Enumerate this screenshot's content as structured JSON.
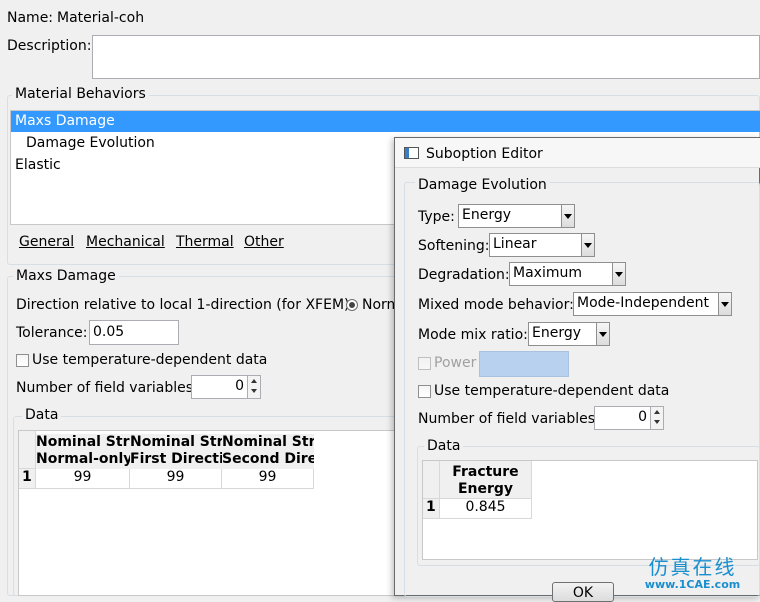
{
  "main": {
    "name_label": "Name:",
    "name_value": "Material-coh",
    "description_label": "Description:",
    "behaviors_title": "Material Behaviors",
    "behaviors": [
      "Maxs Damage",
      "Damage Evolution",
      "Elastic"
    ],
    "menus": [
      "General",
      "Mechanical",
      "Thermal",
      "Other"
    ],
    "section_title": "Maxs Damage",
    "direction_label": "Direction relative to local 1-direction (for XFEM):",
    "direction_option": "Norm",
    "tolerance_label": "Tolerance:",
    "tolerance_value": "0.05",
    "temp_dep_label": "Use temperature-dependent data",
    "field_vars_label": "Number of field variables:",
    "field_vars_value": "0",
    "data_title": "Data",
    "table": {
      "headers": [
        [
          "Nominal Stress",
          "Normal-only Mode"
        ],
        [
          "Nominal Stress",
          "First Direction"
        ],
        [
          "Nominal Stress",
          "Second Direction"
        ]
      ],
      "row_number": "1",
      "values": [
        "99",
        "99",
        "99"
      ]
    }
  },
  "dialog": {
    "title": "Suboption Editor",
    "group_title": "Damage Evolution",
    "type_label": "Type:",
    "type_value": "Energy",
    "softening_label": "Softening:",
    "softening_value": "Linear",
    "degradation_label": "Degradation:",
    "degradation_value": "Maximum",
    "mixed_label": "Mixed mode behavior:",
    "mixed_value": "Mode-Independent",
    "ratio_label": "Mode mix ratio:",
    "ratio_value": "Energy",
    "power_label": "Power",
    "temp_dep_label": "Use temperature-dependent data",
    "field_vars_label": "Number of field variables:",
    "field_vars_value": "0",
    "data_title": "Data",
    "table": {
      "header_line1": "Fracture",
      "header_line2": "Energy",
      "row_number": "1",
      "value": "0.845"
    },
    "ok_label": "OK"
  },
  "watermark": {
    "line1": "仿真在线",
    "line2": "www.1CAE.com"
  },
  "colors": {
    "selection": "#3399ff",
    "window_bg": "#f0f0f0",
    "watermark_text": "#1a8fcf"
  }
}
